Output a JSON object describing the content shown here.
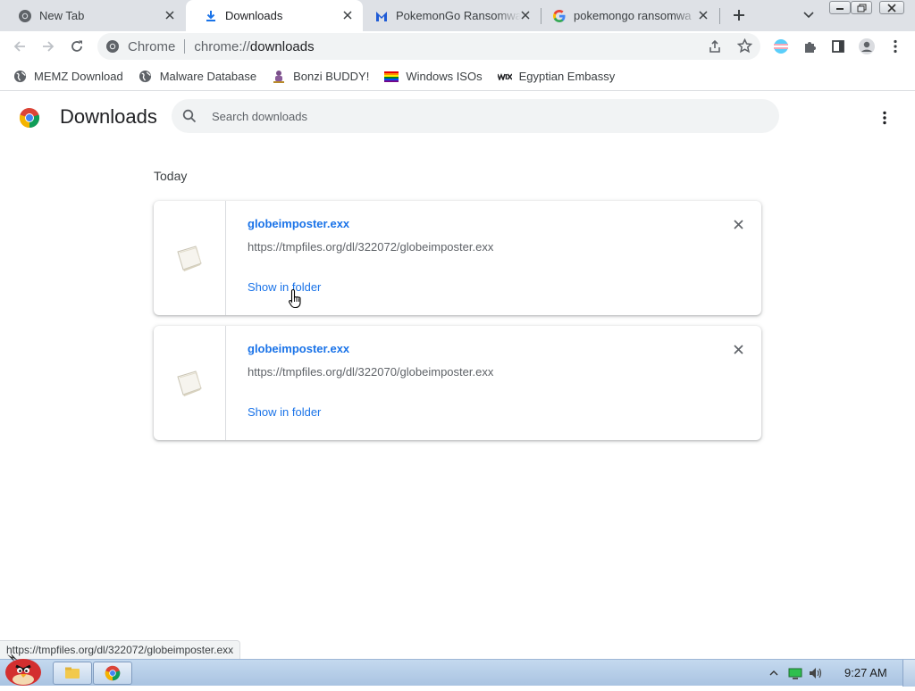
{
  "tabs": [
    {
      "title": "New Tab",
      "icon": "chrome-icon",
      "active": false
    },
    {
      "title": "Downloads",
      "icon": "download-icon",
      "active": true
    },
    {
      "title": "PokemonGo Ransomwa",
      "icon": "malwarebytes-icon",
      "active": false
    },
    {
      "title": "pokemongo ransomwa",
      "icon": "google-icon",
      "active": false
    }
  ],
  "omnibox": {
    "site": "Chrome",
    "scheme": "chrome://",
    "host": "downloads"
  },
  "bookmarks": [
    {
      "label": "MEMZ Download",
      "icon": "globe-icon"
    },
    {
      "label": "Malware Database",
      "icon": "globe-icon"
    },
    {
      "label": "Bonzi BUDDY!",
      "icon": "bonzi-icon"
    },
    {
      "label": "Windows ISOs",
      "icon": "rainbow-flag-icon"
    },
    {
      "label": "Egyptian Embassy",
      "icon": "wix-icon"
    }
  ],
  "page": {
    "title": "Downloads",
    "search_placeholder": "Search downloads",
    "section": "Today"
  },
  "downloads": [
    {
      "filename": "globeimposter.exx",
      "url": "https://tmpfiles.org/dl/322072/globeimposter.exx",
      "action": "Show in folder"
    },
    {
      "filename": "globeimposter.exx",
      "url": "https://tmpfiles.org/dl/322070/globeimposter.exx",
      "action": "Show in folder"
    }
  ],
  "status_url": "https://tmpfiles.org/dl/322072/globeimposter.exx",
  "taskbar": {
    "clock": "9:27 AM"
  },
  "colors": {
    "link": "#1a73e8",
    "tabstrip": "#dee1e6",
    "omnibox": "#f1f3f4",
    "taskbar": "#b8cfe8"
  }
}
